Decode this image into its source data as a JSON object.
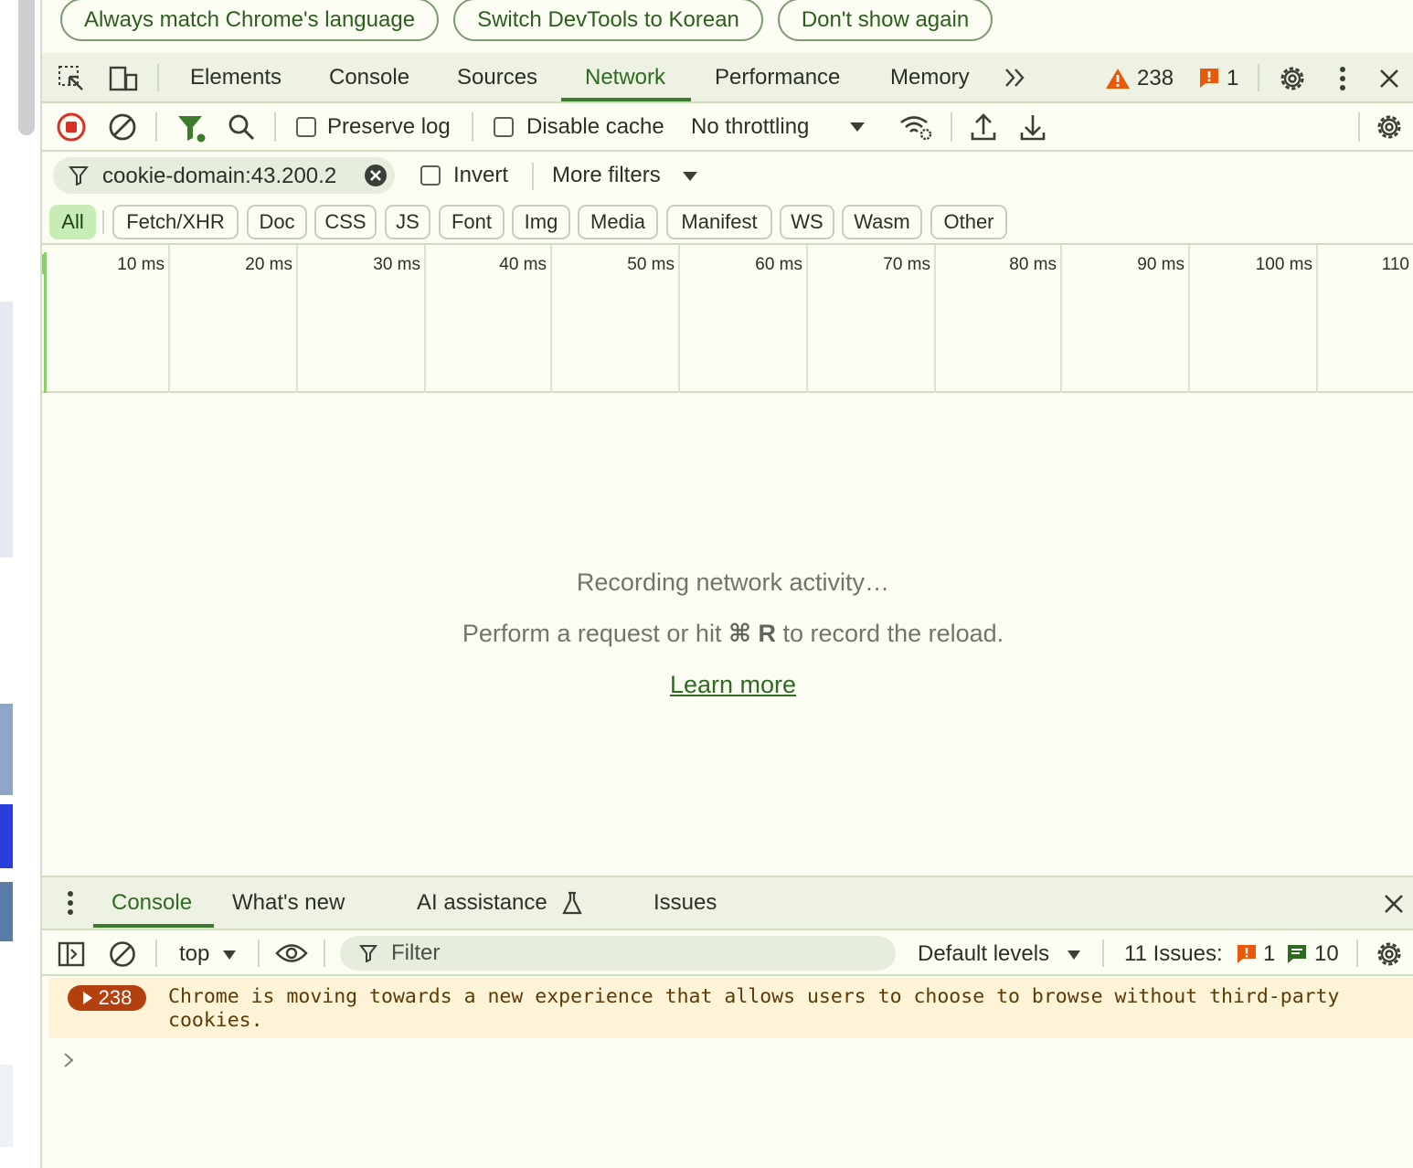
{
  "language_bar": {
    "match_language": "Always match Chrome's language",
    "switch_language": "Switch DevTools to Korean",
    "dont_show": "Don't show again"
  },
  "main_tabs": {
    "items": [
      "Elements",
      "Console",
      "Sources",
      "Network",
      "Performance",
      "Memory"
    ],
    "active": "Network",
    "warnings_count": "238",
    "errors_count": "1"
  },
  "network_toolbar": {
    "preserve_log": "Preserve log",
    "disable_cache": "Disable cache",
    "throttling": "No throttling"
  },
  "filter": {
    "value": "cookie-domain:43.200.2",
    "invert": "Invert",
    "more_filters": "More filters"
  },
  "type_filters": [
    "All",
    "Fetch/XHR",
    "Doc",
    "CSS",
    "JS",
    "Font",
    "Img",
    "Media",
    "Manifest",
    "WS",
    "Wasm",
    "Other"
  ],
  "timeline_ticks": [
    "10 ms",
    "20 ms",
    "30 ms",
    "40 ms",
    "50 ms",
    "60 ms",
    "70 ms",
    "80 ms",
    "90 ms",
    "100 ms",
    "110"
  ],
  "empty_state": {
    "recording": "Recording network activity…",
    "hint_prefix": "Perform a request or hit ",
    "hint_keys": "⌘ R",
    "hint_suffix": " to record the reload.",
    "learn_more": "Learn more"
  },
  "drawer": {
    "tabs": [
      "Console",
      "What's new",
      "AI assistance",
      "Issues"
    ],
    "active_tab": "Console",
    "context": "top",
    "filter_placeholder": "Filter",
    "levels": "Default levels",
    "issues_label": "11 Issues:",
    "issues_errors": "1",
    "issues_info": "10"
  },
  "console": {
    "warning_count": "238",
    "warning_message": "Chrome is moving towards a new experience that allows users to choose to browse without third-party cookies."
  },
  "colors": {
    "accent": "#2e6a1f",
    "background": "#fbfdf3",
    "warning": "#e8590c",
    "error": "#e8590c"
  }
}
